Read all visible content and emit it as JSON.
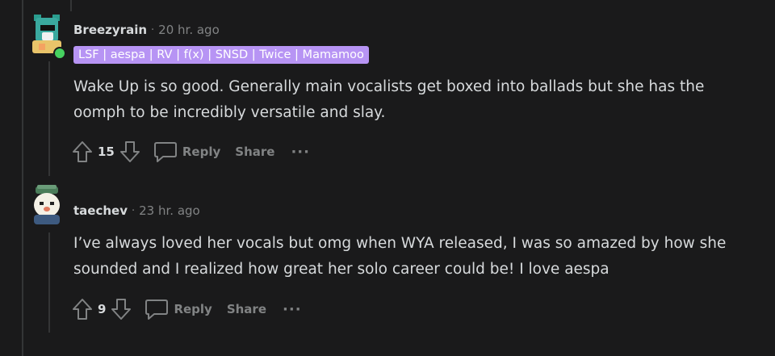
{
  "comments": [
    {
      "username": "Breezyrain",
      "separator": "·",
      "time": "20 hr. ago",
      "flair": "LSF | aespa | RV | f(x) | SNSD | Twice | Mamamoo",
      "line1": "Wake Up is so good. Generally main vocalists get boxed into ballads but she has the",
      "line2": "oomph to be incredibly versatile and slay.",
      "votes": "15",
      "reply_label": "Reply",
      "share_label": "Share",
      "more_label": "···",
      "online": true
    },
    {
      "username": "taechev",
      "separator": "·",
      "time": "23 hr. ago",
      "line1": "I’ve always loved her vocals but omg when WYA released, I was so amazed by how she",
      "line2": "sounded and I realized how great her solo career could be! I love aespa",
      "votes": "9",
      "reply_label": "Reply",
      "share_label": "Share",
      "more_label": "···"
    }
  ],
  "colors": {
    "background": "#1a1a1b",
    "text": "#d7dadc",
    "muted": "#818384",
    "flair_bg": "#b794f4",
    "online": "#46d160"
  },
  "icons": [
    "upvote-icon",
    "downvote-icon",
    "comment-bubble-icon",
    "more-icon"
  ]
}
